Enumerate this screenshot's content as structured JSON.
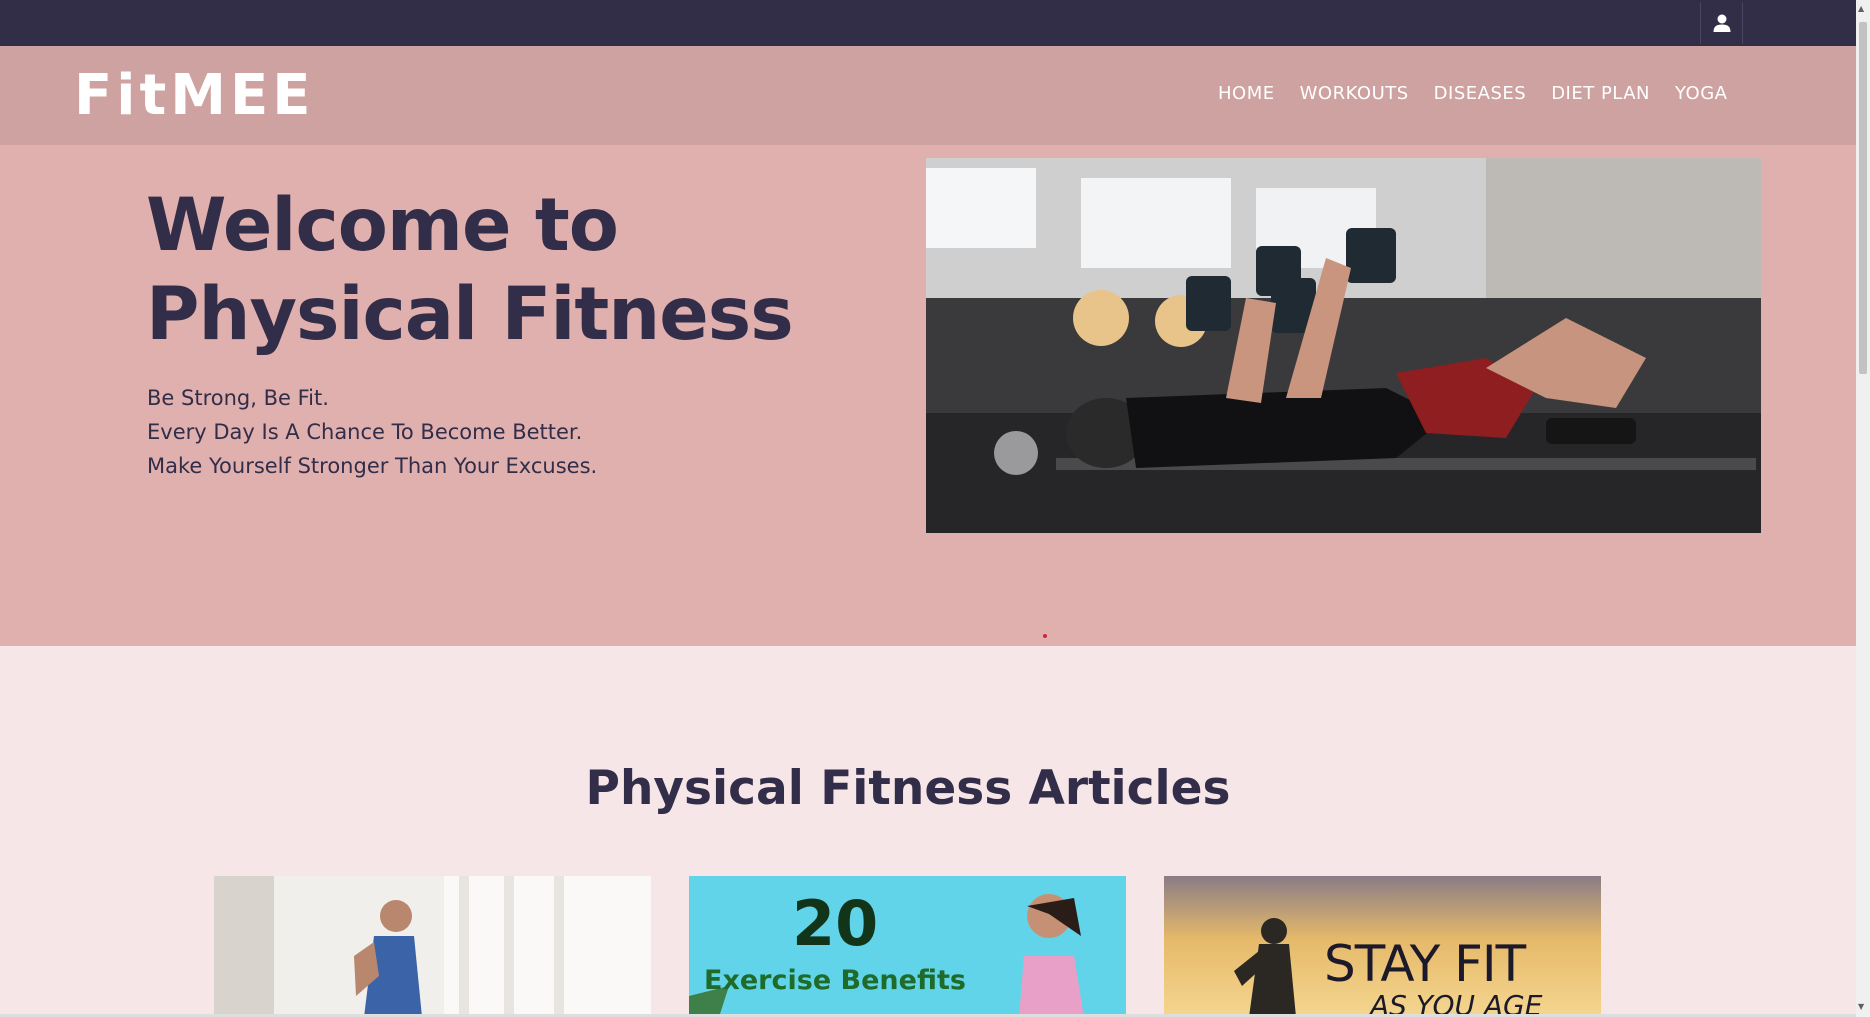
{
  "header": {
    "user_icon": "user-icon"
  },
  "nav": {
    "logo": "FitMEE",
    "links": [
      "HOME",
      "WORKOUTS",
      "DISEASES",
      "DIET PLAN",
      "YOGA"
    ]
  },
  "hero": {
    "title_line1": "Welcome to",
    "title_line2": "Physical Fitness",
    "lines": [
      "Be Strong, Be Fit.",
      "Every Day Is A Chance To Become Better.",
      "Make Yourself Stronger Than Your Excuses."
    ]
  },
  "articles": {
    "heading": "Physical Fitness Articles",
    "cards": [
      {
        "image_text": ""
      },
      {
        "image_text_number": "20",
        "image_text_caption": "Exercise Benefits"
      },
      {
        "image_text_main": "STAY FIT",
        "image_text_sub": "AS YOU AGE"
      }
    ]
  },
  "colors": {
    "topbar": "#332e48",
    "navbar": "#cea2a0",
    "hero": "#e0b0ae",
    "page": "#f7e6e8",
    "heading_text": "#322d49"
  }
}
